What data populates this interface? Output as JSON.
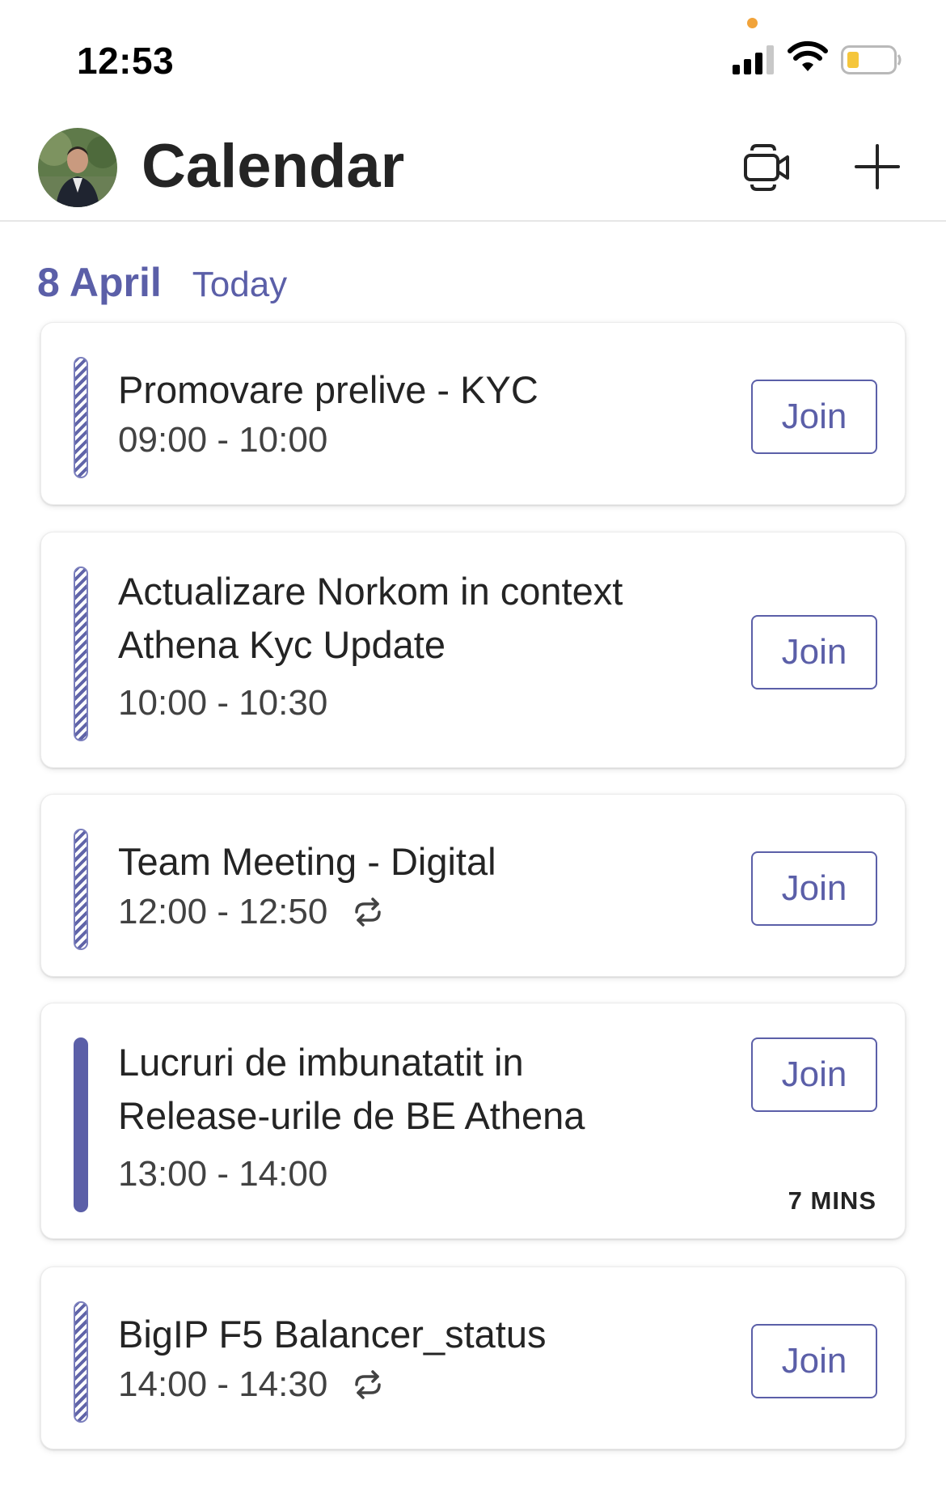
{
  "status_bar": {
    "time": "12:53",
    "privacy_dot_color": "#f1a33a",
    "battery_color": "#f5c63b"
  },
  "header": {
    "title": "Calendar",
    "icons": [
      "avatar",
      "video-meet-icon",
      "plus-icon"
    ]
  },
  "date_section": {
    "date": "8 April",
    "relative": "Today"
  },
  "theme": {
    "accent": "#5b5fa8"
  },
  "events": [
    {
      "title": "Promovare prelive - KYC",
      "time": "09:00 - 10:00",
      "recurring": false,
      "join_label": "Join",
      "bar_style": "striped"
    },
    {
      "title": "Actualizare Norkom in context Athena Kyc Update",
      "time": "10:00 - 10:30",
      "recurring": false,
      "join_label": "Join",
      "bar_style": "striped"
    },
    {
      "title": "Team Meeting - Digital",
      "time": "12:00 - 12:50",
      "recurring": true,
      "join_label": "Join",
      "bar_style": "striped"
    },
    {
      "title": "Lucruri de imbunatatit in Release-urile de BE Athena",
      "time": "13:00 - 14:00",
      "recurring": false,
      "join_label": "Join",
      "bar_style": "solid",
      "time_until": "7 MINS"
    },
    {
      "title": "BigIP F5 Balancer_status",
      "time": "14:00 - 14:30",
      "recurring": true,
      "join_label": "Join",
      "bar_style": "striped"
    }
  ]
}
